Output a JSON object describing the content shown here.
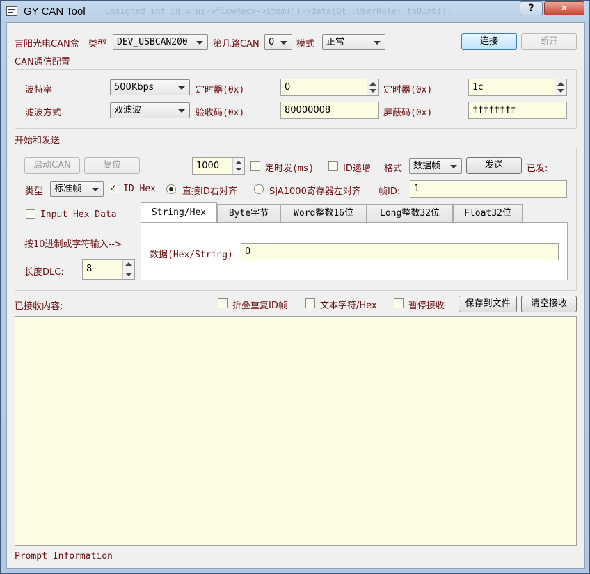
{
  "window": {
    "title": "GY CAN Tool",
    "background_code": "unsigned int id = ui->flowRecv->item(j)->data(Qt::UserRole).toUInt();",
    "help_label": "?",
    "close_label": "✕"
  },
  "device": {
    "box_label": "吉阳光电CAN盒",
    "type_label": "类型",
    "type_value": "DEV_USBCAN200",
    "channel_label": "第几路CAN",
    "channel_value": "0",
    "mode_label": "模式",
    "mode_value": "正常",
    "connect_label": "连接",
    "disconnect_label": "断开"
  },
  "config": {
    "section_title": "CAN通信配置",
    "baud_label": "波特率",
    "baud_value": "500Kbps",
    "timer0_label": "定时器(0x)",
    "timer0_value": "0",
    "timer1_label": "定时器(0x)",
    "timer1_value": "1c",
    "filter_label": "滤波方式",
    "filter_value": "双滤波",
    "acc_code_label": "验收码(0x)",
    "acc_code_value": "80000008",
    "mask_label": "屏蔽码(0x)",
    "mask_value": "ffffffff"
  },
  "send": {
    "section_title": "开始和发送",
    "start_label": "启动CAN",
    "reset_label": "复位",
    "interval_value": "1000",
    "timed_label": "定时发(ms)",
    "id_inc_label": "ID递增",
    "format_label": "格式",
    "format_value": "数据帧",
    "send_label": "发送",
    "sent_label": "已发:",
    "type_label": "类型",
    "type_value": "标准帧",
    "id_hex_label": "ID Hex",
    "align_right_label": "直接ID右对齐",
    "align_left_label": "SJA1000寄存器左对齐",
    "frame_id_label": "帧ID:",
    "frame_id_value": "1",
    "input_hex_label": "Input Hex Data",
    "hint_label": "按10进制或字符输入-->",
    "dlc_label": "长度DLC:",
    "dlc_value": "8",
    "tabs": [
      "String/Hex",
      "Byte字节",
      "Word整数16位",
      "Long整数32位",
      "Float32位"
    ],
    "data_label": "数据(Hex/String)",
    "data_value": "0"
  },
  "receive": {
    "title": "已接收内容:",
    "fold_label": "折叠重复ID帧",
    "text_label": "文本字符/Hex",
    "pause_label": "暂停接收",
    "save_label": "保存到文件",
    "clear_label": "清空接收"
  },
  "status": {
    "prompt": "Prompt Information"
  },
  "colors": {
    "field_bg": "#fdfde3",
    "label_maroon": "#6b0d0d",
    "window_frame": "#b9cfe6"
  }
}
